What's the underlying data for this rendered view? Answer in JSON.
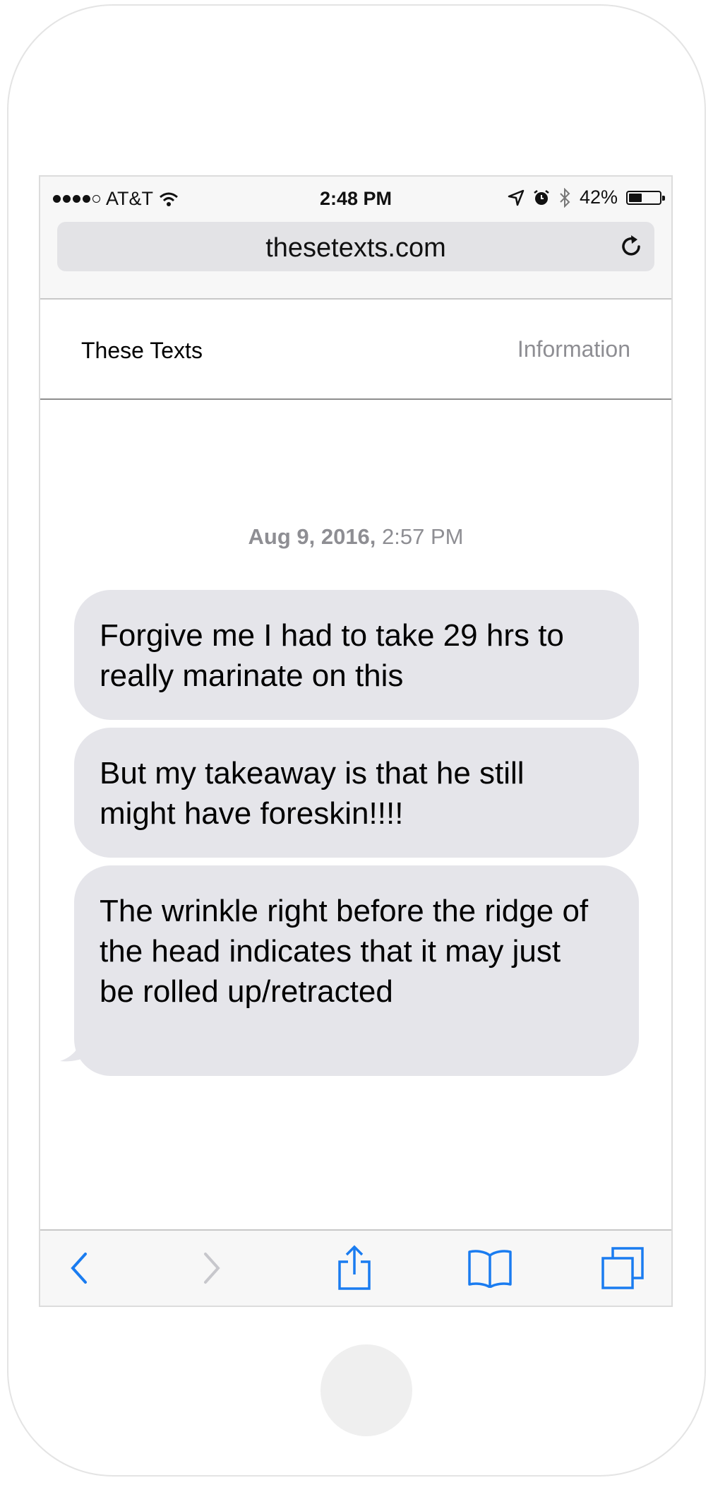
{
  "status_bar": {
    "carrier": "AT&T",
    "time": "2:48 PM",
    "battery_percent": "42%",
    "battery_level": 0.42,
    "signal_bars": 4,
    "signal_max": 5
  },
  "address_bar": {
    "url": "thesetexts.com"
  },
  "site_header": {
    "title": "These Texts",
    "info_link": "Information"
  },
  "conversation": {
    "timestamp_date": "Aug 9, 2016,",
    "timestamp_time": " 2:57 PM",
    "messages": [
      {
        "text": "Forgive me I had to take 29 hrs to really marinate on this"
      },
      {
        "text": "But my takeaway is that he still might have foreskin!!!!"
      },
      {
        "text": "The wrinkle right before the ridge of the head indicates that it may just be rolled up/retracted"
      }
    ]
  },
  "colors": {
    "bubble_bg": "#e5e5ea",
    "ios_blue": "#1a7cf0",
    "secondary_text": "#8e8e93"
  },
  "icons": [
    "wifi-icon",
    "location-arrow-icon",
    "alarm-icon",
    "bluetooth-icon",
    "battery-icon",
    "reload-icon",
    "back-chevron-icon",
    "forward-chevron-icon",
    "share-icon",
    "bookmarks-icon",
    "tabs-icon"
  ]
}
